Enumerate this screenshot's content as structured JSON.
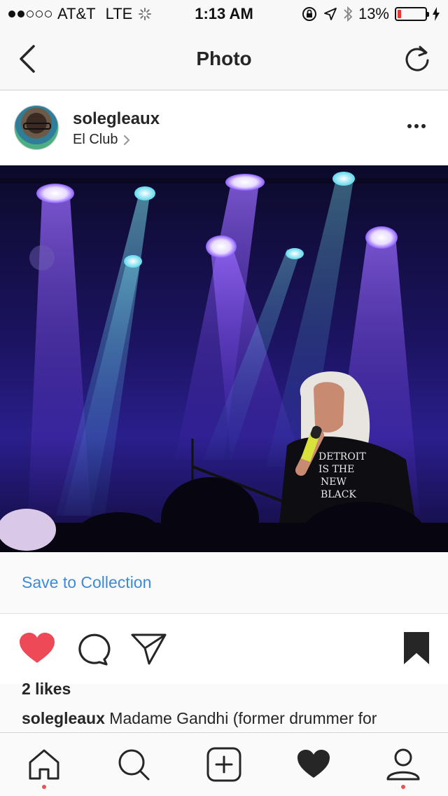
{
  "status_bar": {
    "carrier": "AT&T",
    "network": "LTE",
    "time": "1:13 AM",
    "battery": "13%",
    "battery_level": 0.13,
    "signal_bars_filled": 2,
    "signal_bars_total": 5
  },
  "nav": {
    "title": "Photo"
  },
  "post": {
    "username": "solegleaux",
    "location": "El Club",
    "likes": "2 likes",
    "caption_user": "solegleaux",
    "caption_text": "Madame Gandhi (former drummer for"
  },
  "save_collection": {
    "label": "Save to Collection"
  },
  "photo": {
    "shirt_text": [
      "DETROIT",
      "IS THE",
      "NEW",
      "BLACK"
    ]
  },
  "colors": {
    "like_red": "#ed4956",
    "link_blue": "#3f8ad8",
    "battery_red": "#e53935",
    "stage_purple": "#7a4cff",
    "stage_cyan": "#7fe6f0"
  },
  "icons": {
    "back": "chevron-left-icon",
    "refresh": "refresh-icon",
    "more": "more-dots-icon",
    "like": "heart-filled-icon",
    "comment": "comment-icon",
    "share": "paper-plane-icon",
    "save": "bookmark-filled-icon",
    "home": "home-icon",
    "search": "search-icon",
    "add": "add-post-icon",
    "activity": "heart-tab-icon",
    "profile": "profile-icon"
  }
}
